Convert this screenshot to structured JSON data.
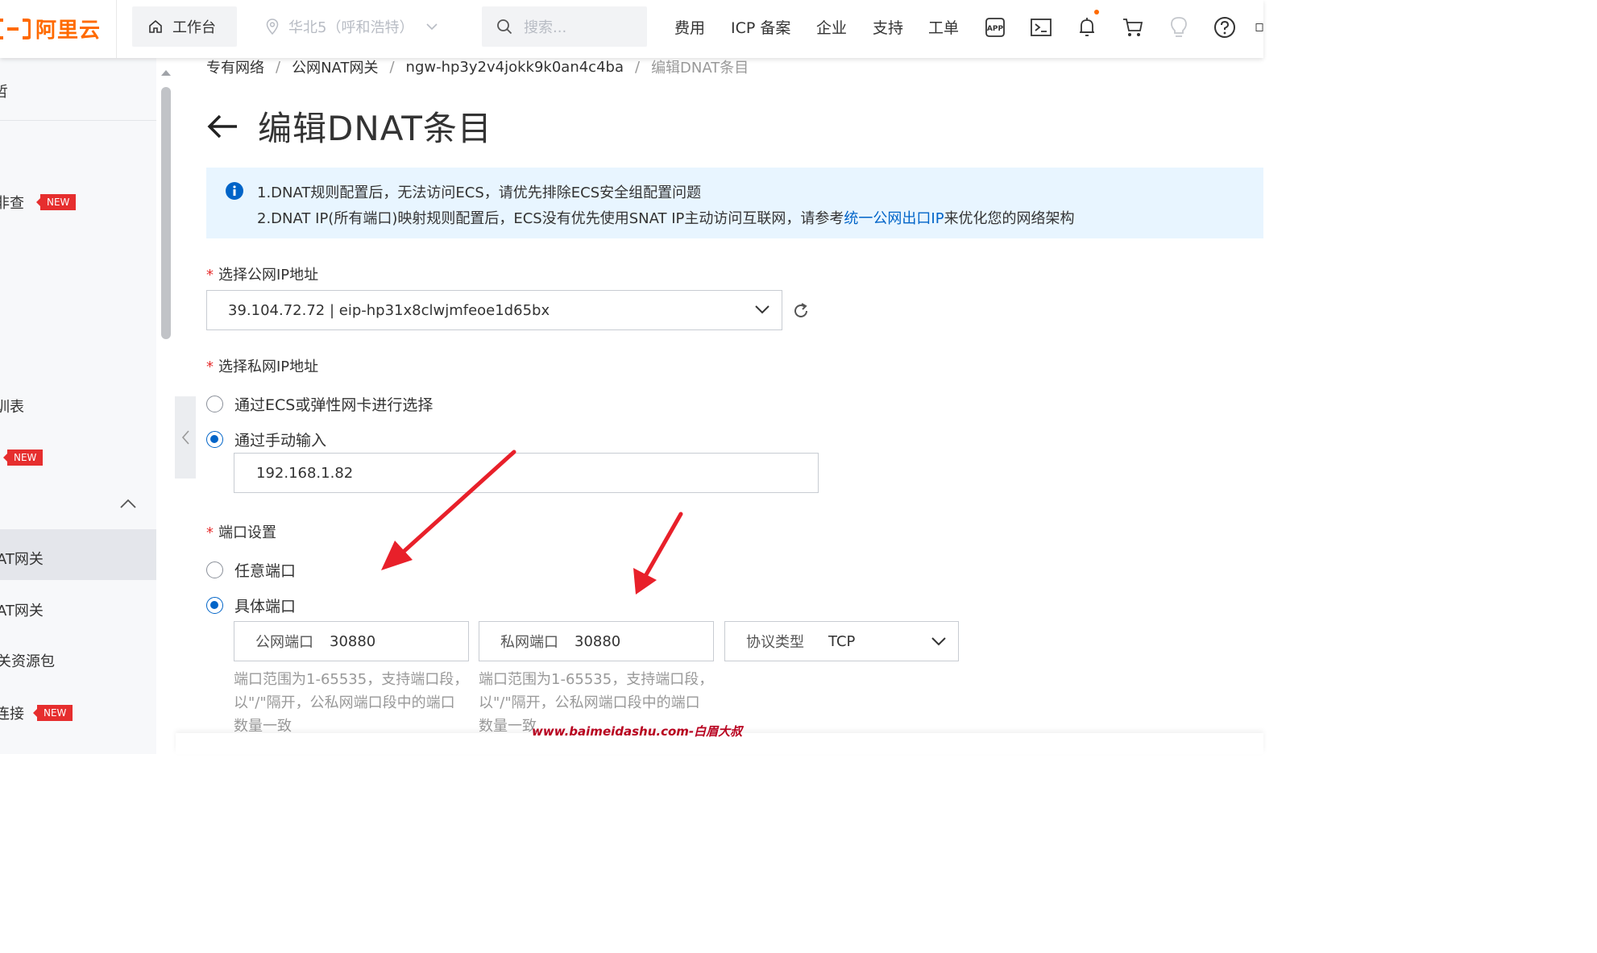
{
  "brand": {
    "logo_text": "阿里云",
    "color": "#ff6a00"
  },
  "topbar": {
    "workbench": "工作台",
    "region": "华北5（呼和浩特）",
    "search_placeholder": "搜索...",
    "nav": [
      "费用",
      "ICP 备案",
      "企业",
      "支持",
      "工单"
    ],
    "icons": [
      "app-icon",
      "terminal-icon",
      "bell-icon",
      "cart-icon",
      "bulb-icon",
      "help-icon"
    ]
  },
  "sidebar": {
    "items": [
      {
        "label": "哲"
      },
      {
        "label": "非查",
        "badge": "NEW"
      },
      {
        "label": "训表"
      },
      {
        "label": "",
        "badge": "NEW"
      },
      {
        "label": "AT网关",
        "active": true
      },
      {
        "label": "AT网关"
      },
      {
        "label": "关资源包"
      },
      {
        "label": "连接",
        "badge": "NEW"
      }
    ]
  },
  "breadcrumb": [
    "专有网络",
    "公网NAT网关",
    "ngw-hp3y2v4jokk9k0an4c4ba",
    "编辑DNAT条目"
  ],
  "page": {
    "title": "编辑DNAT条目"
  },
  "alert": {
    "line1": "1.DNAT规则配置后，无法访问ECS，请优先排除ECS安全组配置问题",
    "line2_pre": "2.DNAT IP(所有端口)映射规则配置后，ECS没有优先使用SNAT IP主动访问互联网，请参考",
    "line2_link": "统一公网出口IP",
    "line2_post": "来优化您的网络架构"
  },
  "form": {
    "public_ip": {
      "label": "选择公网IP地址",
      "value": "39.104.72.72 | eip-hp31x8clwjmfeoe1d65bx"
    },
    "private_ip": {
      "label": "选择私网IP地址",
      "option_ecs": "通过ECS或弹性网卡进行选择",
      "option_manual": "通过手动输入",
      "selected": "manual",
      "value": "192.168.1.82"
    },
    "port": {
      "label": "端口设置",
      "option_any": "任意端口",
      "option_specific": "具体端口",
      "selected": "specific",
      "public_label": "公网端口",
      "public_value": "30880",
      "private_label": "私网端口",
      "private_value": "30880",
      "protocol_label": "协议类型",
      "protocol_value": "TCP",
      "hint": "端口范围为1-65535，支持端口段，以\"/\"隔开，公私网端口段中的端口数量一致"
    }
  },
  "watermark": "www.baimeidashu.com-白眉大叔",
  "colors": {
    "accent": "#0064c8",
    "required": "#e62e2e",
    "annotation_arrow": "#e8202a"
  }
}
